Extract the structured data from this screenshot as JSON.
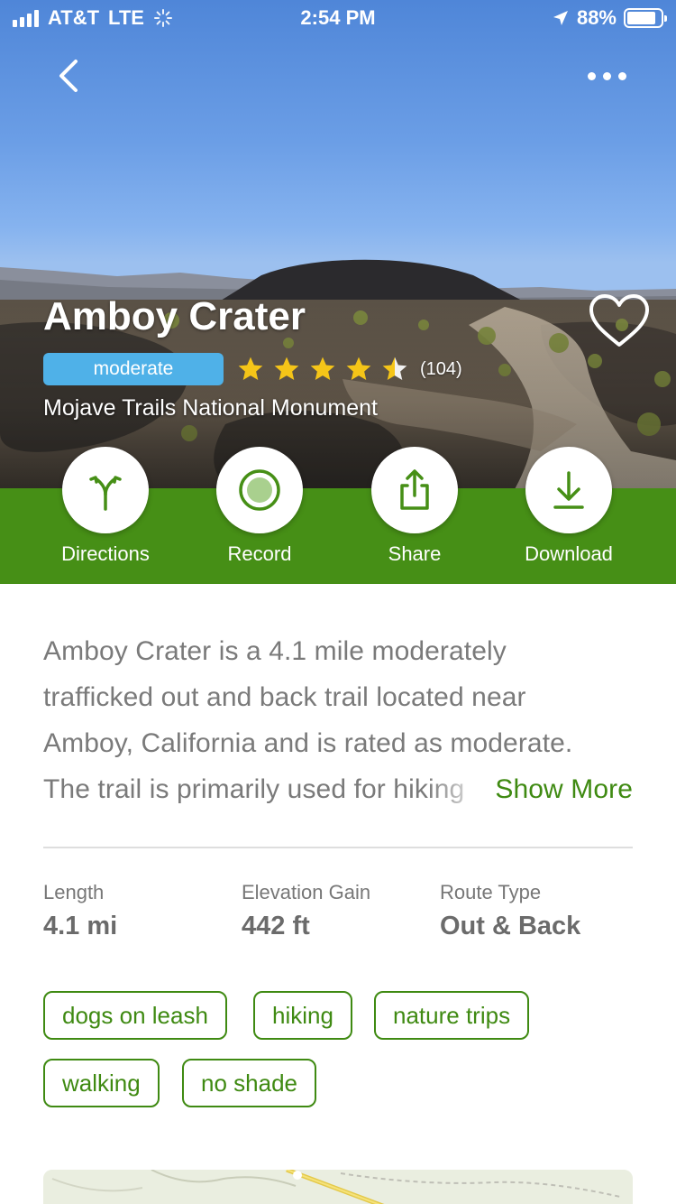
{
  "status_bar": {
    "carrier": "AT&T",
    "network": "LTE",
    "time": "2:54 PM",
    "battery": "88%"
  },
  "hero": {
    "trail_name": "Amboy Crater",
    "difficulty": "moderate",
    "rating_stars": 4.5,
    "review_count": "(104)",
    "location": "Mojave Trails National Monument"
  },
  "actions": [
    {
      "label": "Directions",
      "icon": "directions-icon"
    },
    {
      "label": "Record",
      "icon": "record-icon"
    },
    {
      "label": "Share",
      "icon": "share-icon"
    },
    {
      "label": "Download",
      "icon": "download-icon"
    }
  ],
  "description": {
    "lines": [
      "Amboy Crater is a 4.1 mile moderately",
      "trafficked out and back trail located near",
      "Amboy, California and is rated as moderate.",
      "The trail is primarily used for hiking"
    ],
    "show_more": "Show More"
  },
  "stats": [
    {
      "label": "Length",
      "value": "4.1 mi"
    },
    {
      "label": "Elevation Gain",
      "value": "442 ft"
    },
    {
      "label": "Route Type",
      "value": "Out & Back"
    }
  ],
  "tags": [
    "dogs on leash",
    "hiking",
    "nature trips",
    "walking",
    "no shade"
  ],
  "colors": {
    "brand_green": "#468f16",
    "tag_green": "#3f8a12",
    "difficulty_blue": "#4fb1e8",
    "star_yellow": "#f5c518"
  }
}
